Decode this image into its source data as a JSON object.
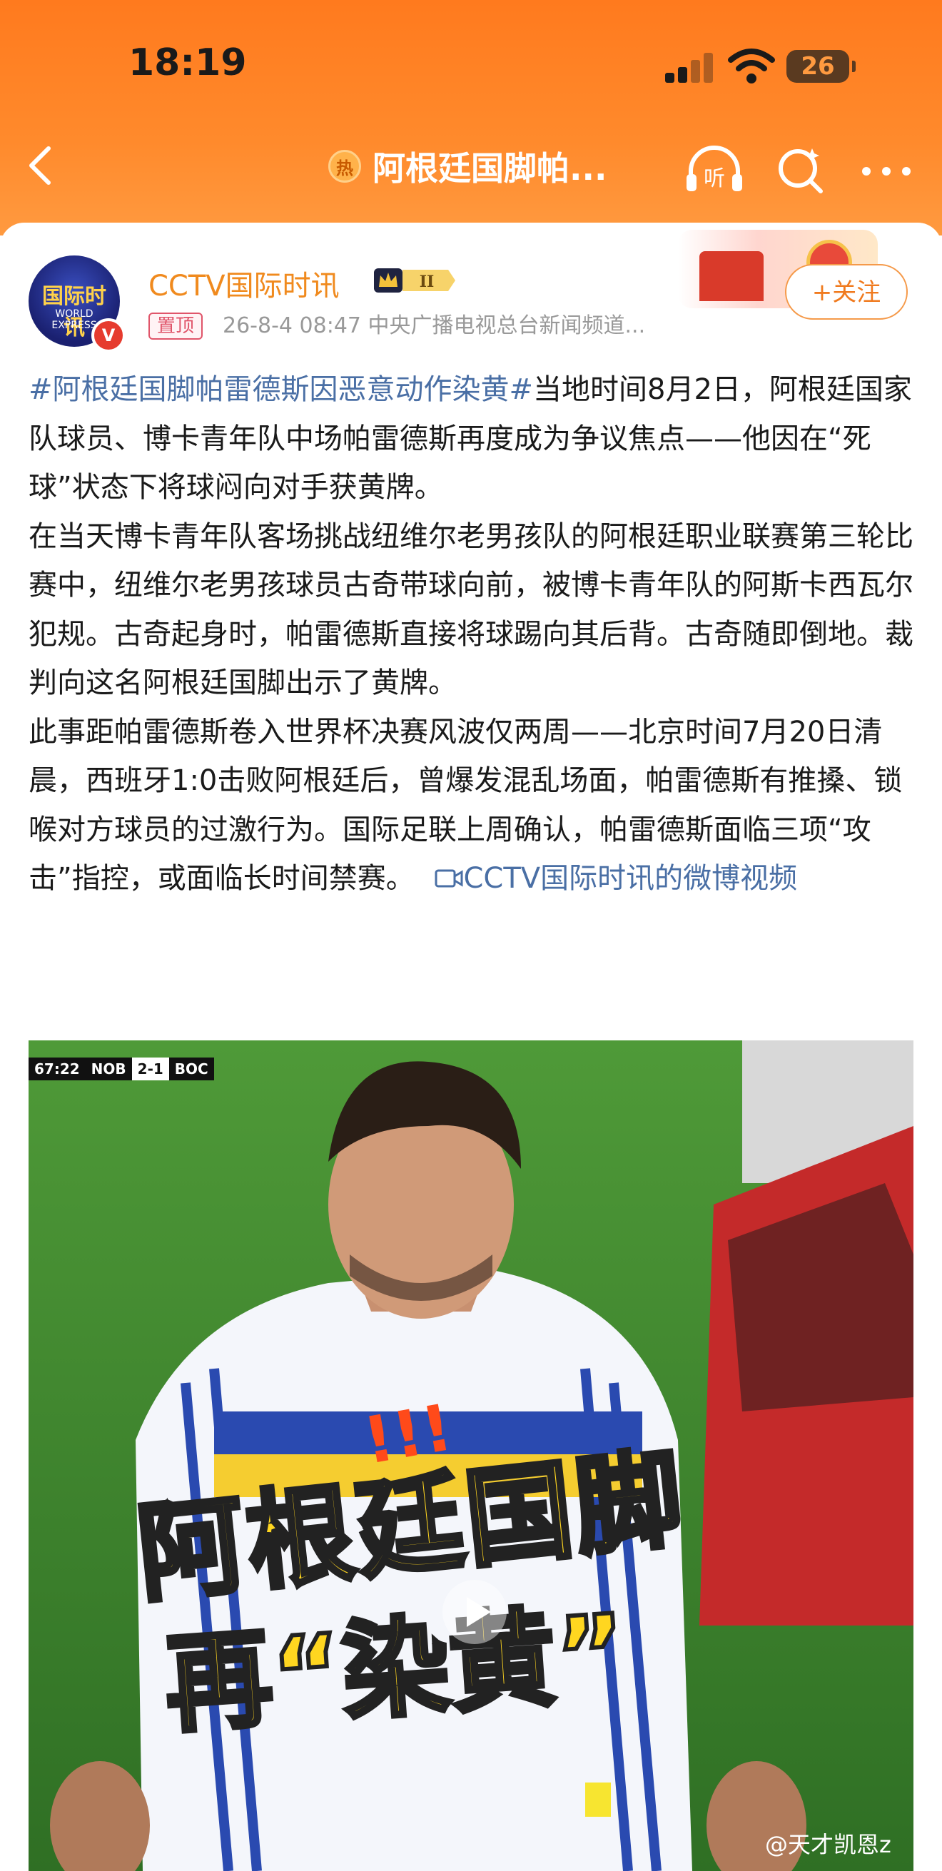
{
  "status_bar": {
    "time": "18:19",
    "battery": "26"
  },
  "nav": {
    "hot_badge": "热",
    "title": "阿根廷国脚帕...",
    "listen_label": "听"
  },
  "post": {
    "author": "CCTV国际时讯",
    "level_badge": "II",
    "avatar_text_top": "国际时讯",
    "avatar_text_bottom": "WORLD EXPRESS",
    "verified": "V",
    "pinned": "置顶",
    "meta": "26-8-4 08:47  中央广播电视总台新闻频道...",
    "follow_label": "+关注",
    "hashtag": "#阿根廷国脚帕雷德斯因恶意动作染黄#",
    "para1": "当地时间8月2日，阿根廷国家队球员、博卡青年队中场帕雷德斯再度成为争议焦点——他因在“死球”状态下将球闷向对手获黄牌。",
    "para2": "在当天博卡青年队客场挑战纽维尔老男孩队的阿根廷职业联赛第三轮比赛中，纽维尔老男孩球员古奇带球向前，被博卡青年队的阿斯卡西瓦尔犯规。古奇起身时，帕雷德斯直接将球踢向其后背。古奇随即倒地。裁判向这名阿根廷国脚出示了黄牌。",
    "para3": "此事距帕雷德斯卷入世界杯决赛风波仅两周——北京时间7月20日清晨，西班牙1:0击败阿根廷后，曾爆发混乱场面，帕雷德斯有推搡、锁喉对方球员的过激行为。国际足联上周确认，帕雷德斯面临三项“攻击”指控，或面临长时间禁赛。",
    "video_link": "CCTV国际时讯的微博视频"
  },
  "video": {
    "score_time": "67:22",
    "team_home": "NOB",
    "score": "2-1",
    "team_away": "BOC",
    "overlay_line1": "阿根廷国脚",
    "overlay_line2": "再“染黄”",
    "exclaim": "!!!"
  },
  "watermark": "@天才凯恩z",
  "colors": {
    "header": "#ff8a2c",
    "author": "#f08a1e",
    "link": "#4a6fa5"
  }
}
